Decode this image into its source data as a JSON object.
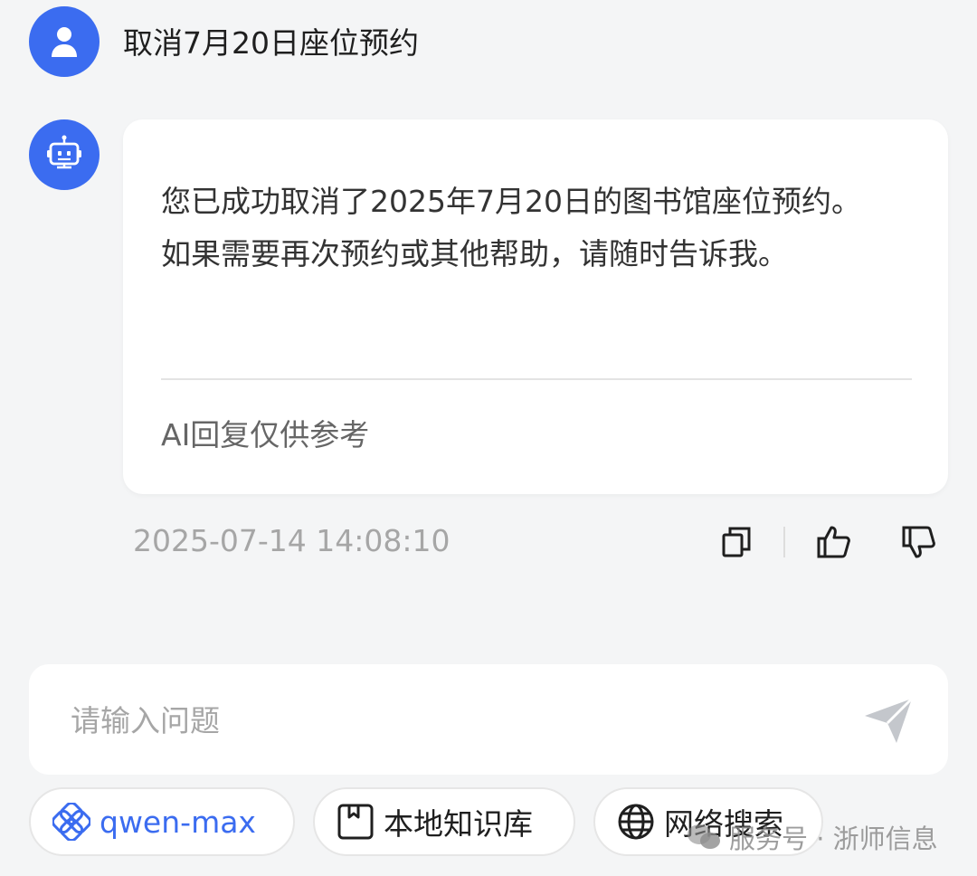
{
  "user_message": {
    "text": "取消7月20日座位预约",
    "avatar_icon": "user-icon"
  },
  "bot_message": {
    "avatar_icon": "robot-icon",
    "text": "您已成功取消了2025年7月20日的图书馆座位预约。如果需要再次预约或其他帮助，请随时告诉我。",
    "disclaimer": "AI回复仅供参考",
    "timestamp": "2025-07-14 14:08:10",
    "actions": [
      "copy-icon",
      "thumbs-up-icon",
      "thumbs-down-icon"
    ]
  },
  "input": {
    "placeholder": "请输入问题",
    "value": "",
    "send_icon": "send-icon"
  },
  "chips": {
    "model": "qwen-max",
    "knowledge_base": "本地知识库",
    "web_search": "网络搜索"
  },
  "watermark": {
    "text": "服务号 · 浙师信息"
  },
  "colors": {
    "accent": "#3b6cf0",
    "background": "#f4f5f6"
  }
}
